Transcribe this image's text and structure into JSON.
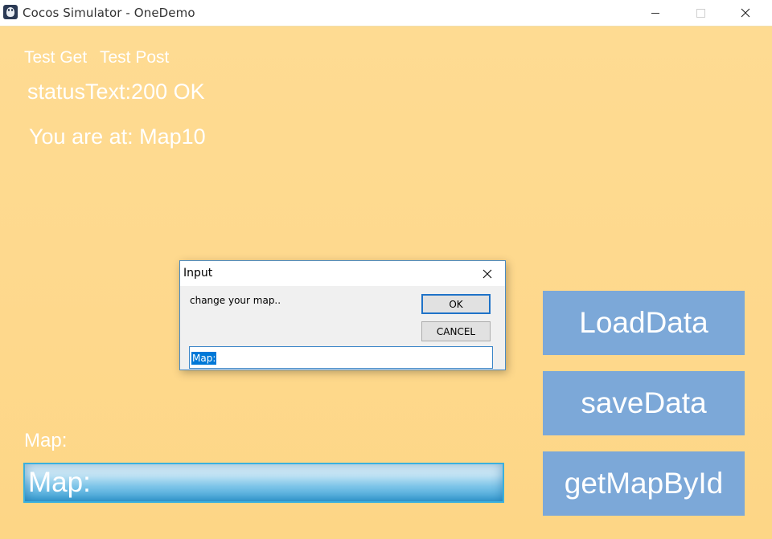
{
  "window": {
    "title": "Cocos Simulator - OneDemo",
    "icon": "cocos-app-icon",
    "controls": {
      "minimize": "minimize-icon",
      "maximize": "maximize-icon",
      "close": "close-icon"
    }
  },
  "scene": {
    "menu": {
      "test_get": "Test Get",
      "test_post": "Test Post"
    },
    "status_text": "statusText:200 OK",
    "location_text": "You are at: Map10",
    "map_label": "Map:",
    "map_input_value": "Map:",
    "buttons": {
      "load": "LoadData",
      "save": "saveData",
      "get": "getMapById"
    },
    "colors": {
      "background": "#fed98e",
      "button": "#7ca8d8",
      "input_border": "#3bb0dd"
    }
  },
  "dialog": {
    "title": "Input",
    "message": "change your map..",
    "ok_label": "OK",
    "cancel_label": "CANCEL",
    "input_value": "Map:"
  }
}
